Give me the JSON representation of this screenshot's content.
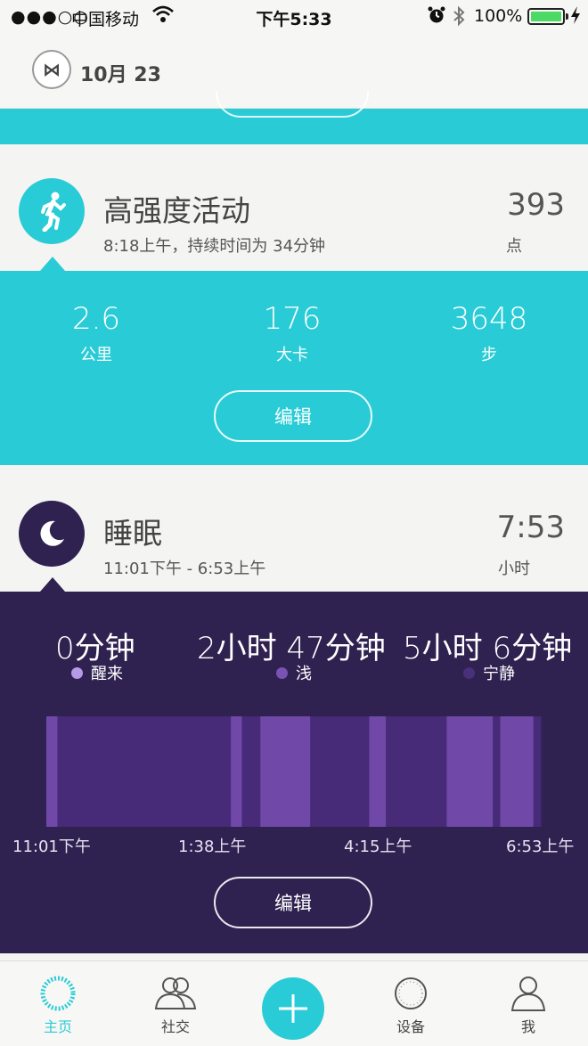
{
  "status_bar": {
    "signal": "●●●○○",
    "carrier": "中国移动",
    "time": "下午5:33",
    "battery_pct": "100%",
    "battery_level": 1.0,
    "icons": [
      "wifi-icon",
      "alarm-icon",
      "bluetooth-icon",
      "charging-icon"
    ]
  },
  "header": {
    "logo": "⋈",
    "date": "10月 23"
  },
  "activity": {
    "title": "高强度活动",
    "subtitle": "8:18上午，持续时间为 34分钟",
    "value": "393",
    "unit": "点",
    "stats": [
      {
        "value": "2.6",
        "label": "公里"
      },
      {
        "value": "176",
        "label": "大卡"
      },
      {
        "value": "3648",
        "label": "步"
      }
    ],
    "edit_label": "编辑",
    "color": "#29ccd6"
  },
  "sleep": {
    "title": "睡眠",
    "subtitle": "11:01下午 - 6:53上午",
    "value": "7:53",
    "unit": "小时",
    "stats": [
      {
        "value": "0分钟",
        "label": "醒来",
        "color": "#b79ae6"
      },
      {
        "value": "2小时 47分钟",
        "label": "浅",
        "color": "#7a52b3"
      },
      {
        "value": "5小时 6分钟",
        "label": "宁静",
        "color": "#4a2f7a"
      }
    ],
    "time_ticks": [
      "11:01下午",
      "1:38上午",
      "4:15上午",
      "6:53上午"
    ],
    "edit_label": "编辑",
    "color": "#2f2150"
  },
  "chart_data": {
    "type": "bar",
    "title": "",
    "xlabel": "",
    "ylabel": "",
    "x_range": [
      "11:01下午",
      "6:53上午"
    ],
    "categories": [
      "浅",
      "宁静",
      "浅",
      "宁静",
      "浅",
      "宁静",
      "浅",
      "宁静",
      "浅",
      "宁静",
      "浅",
      "宁静"
    ],
    "values": [
      6,
      94,
      6,
      10,
      27,
      32,
      9,
      33,
      25,
      4,
      18,
      4
    ],
    "series": [
      {
        "name": "浅",
        "color": "#6f48a8"
      },
      {
        "name": "宁静",
        "color": "#472a78"
      }
    ]
  },
  "tabbar": {
    "tabs": [
      {
        "label": "主页",
        "icon": "home-ring-icon",
        "active": true
      },
      {
        "label": "社交",
        "icon": "people-icon",
        "active": false
      },
      {
        "label": "设备",
        "icon": "device-icon",
        "active": false
      },
      {
        "label": "我",
        "icon": "person-icon",
        "active": false
      }
    ],
    "add_icon": "plus-icon"
  }
}
